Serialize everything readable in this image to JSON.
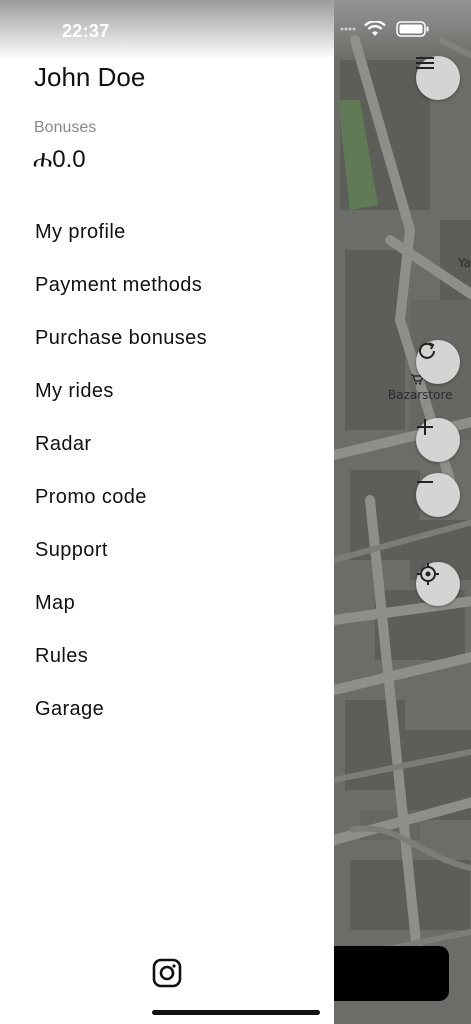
{
  "status_bar": {
    "time": "22:37"
  },
  "drawer": {
    "user_name": "John Doe",
    "bonuses_label": "Bonuses",
    "bonuses_value": "ሐ0.0",
    "menu": [
      {
        "label": "My profile"
      },
      {
        "label": "Payment methods"
      },
      {
        "label": "Purchase bonuses"
      },
      {
        "label": "My rides"
      },
      {
        "label": "Radar"
      },
      {
        "label": "Promo code"
      },
      {
        "label": "Support"
      },
      {
        "label": "Map"
      },
      {
        "label": "Rules"
      },
      {
        "label": "Garage"
      }
    ],
    "footer_icon": "instagram-icon"
  },
  "map": {
    "poi_label": "Bazarstore",
    "edge_label": "Ya",
    "controls": [
      "menu-icon",
      "refresh-icon",
      "plus-icon",
      "minus-icon",
      "locate-icon"
    ]
  }
}
